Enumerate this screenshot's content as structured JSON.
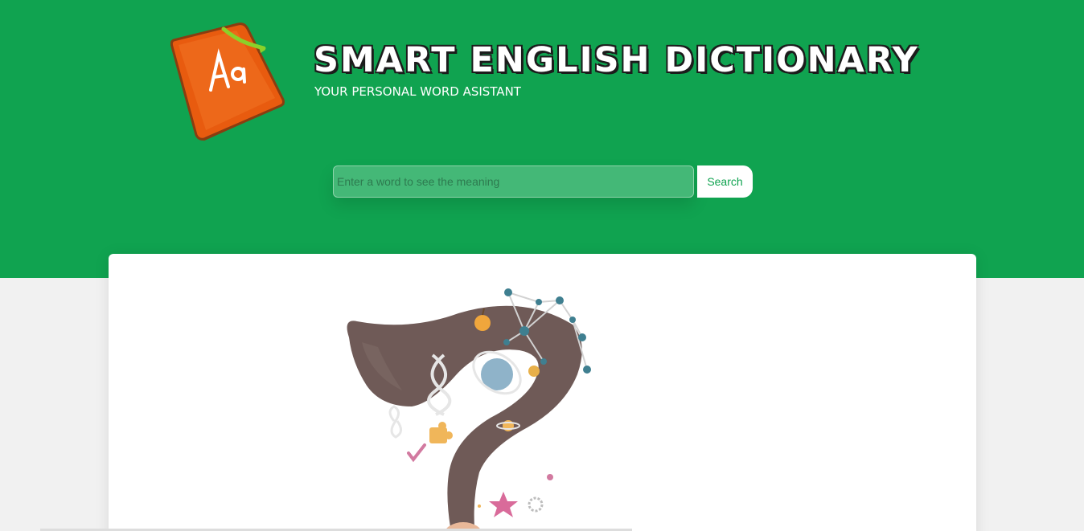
{
  "header": {
    "title": "SMART ENGLISH DICTIONARY",
    "subtitle": "YOUR PERSONAL WORD ASISTANT",
    "logo_icon": "dictionary-book-icon",
    "logo_letters": "Aa"
  },
  "search": {
    "placeholder": "Enter a word to see the meaning",
    "value": "",
    "button_label": "Search"
  },
  "illustration": {
    "icon": "thinking-head-question-mark-illustration"
  },
  "colors": {
    "primary_green": "#10a350",
    "input_green": "#44b877",
    "page_background": "#f1f1f1",
    "card_background": "#ffffff"
  }
}
